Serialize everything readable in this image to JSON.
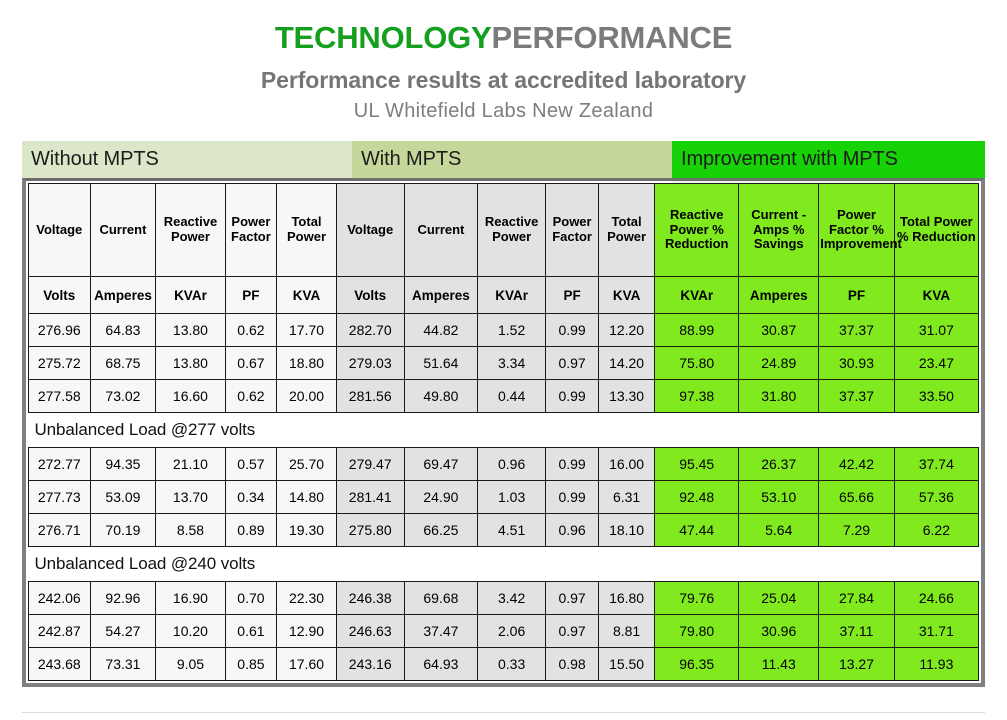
{
  "header": {
    "title_part1": "TECHNOLOGY",
    "title_part2": "PERFORMANCE",
    "subtitle": "Performance results at accredited laboratory",
    "subtitle2": "UL Whitefield Labs New Zealand",
    "colors": {
      "title_green": "#14a01e",
      "title_gray": "#7b7b7b",
      "banner_without": "#dce6c8",
      "banner_with": "#c5d79b",
      "banner_improvement": "#17d207",
      "cell_without": "#f7f7f7",
      "cell_with": "#e2e2e2",
      "cell_improvement": "#80ea1f"
    }
  },
  "banners": {
    "without": "Without MPTS",
    "with": "With MPTS",
    "improvement": "Improvement with MPTS"
  },
  "table": {
    "headers": [
      "Voltage",
      "Current",
      "Reactive Power",
      "Power Factor",
      "Total Power",
      "Voltage",
      "Current",
      "Reactive Power",
      "Power Factor",
      "Total Power",
      "Reactive Power % Reduction",
      "Current - Amps % Savings",
      "Power Factor % Improvement",
      "Total Power % Reduction"
    ],
    "units": [
      "Volts",
      "Amperes",
      "KVAr",
      "PF",
      "KVA",
      "Volts",
      "Amperes",
      "KVAr",
      "PF",
      "KVA",
      "KVAr",
      "Amperes",
      "PF",
      "KVA"
    ],
    "sections": [
      {
        "label": "",
        "rows": [
          [
            "276.96",
            "64.83",
            "13.80",
            "0.62",
            "17.70",
            "282.70",
            "44.82",
            "1.52",
            "0.99",
            "12.20",
            "88.99",
            "30.87",
            "37.37",
            "31.07"
          ],
          [
            "275.72",
            "68.75",
            "13.80",
            "0.67",
            "18.80",
            "279.03",
            "51.64",
            "3.34",
            "0.97",
            "14.20",
            "75.80",
            "24.89",
            "30.93",
            "23.47"
          ],
          [
            "277.58",
            "73.02",
            "16.60",
            "0.62",
            "20.00",
            "281.56",
            "49.80",
            "0.44",
            "0.99",
            "13.30",
            "97.38",
            "31.80",
            "37.37",
            "33.50"
          ]
        ]
      },
      {
        "label": "Unbalanced Load @277 volts",
        "rows": [
          [
            "272.77",
            "94.35",
            "21.10",
            "0.57",
            "25.70",
            "279.47",
            "69.47",
            "0.96",
            "0.99",
            "16.00",
            "95.45",
            "26.37",
            "42.42",
            "37.74"
          ],
          [
            "277.73",
            "53.09",
            "13.70",
            "0.34",
            "14.80",
            "281.41",
            "24.90",
            "1.03",
            "0.99",
            "6.31",
            "92.48",
            "53.10",
            "65.66",
            "57.36"
          ],
          [
            "276.71",
            "70.19",
            "8.58",
            "0.89",
            "19.30",
            "275.80",
            "66.25",
            "4.51",
            "0.96",
            "18.10",
            "47.44",
            "5.64",
            "7.29",
            "6.22"
          ]
        ]
      },
      {
        "label": "Unbalanced Load @240 volts",
        "rows": [
          [
            "242.06",
            "92.96",
            "16.90",
            "0.70",
            "22.30",
            "246.38",
            "69.68",
            "3.42",
            "0.97",
            "16.80",
            "79.76",
            "25.04",
            "27.84",
            "24.66"
          ],
          [
            "242.87",
            "54.27",
            "10.20",
            "0.61",
            "12.90",
            "246.63",
            "37.47",
            "2.06",
            "0.97",
            "8.81",
            "79.80",
            "30.96",
            "37.11",
            "31.71"
          ],
          [
            "243.68",
            "73.31",
            "9.05",
            "0.85",
            "17.60",
            "243.16",
            "64.93",
            "0.33",
            "0.98",
            "15.50",
            "96.35",
            "11.43",
            "13.27",
            "11.93"
          ]
        ]
      }
    ]
  }
}
